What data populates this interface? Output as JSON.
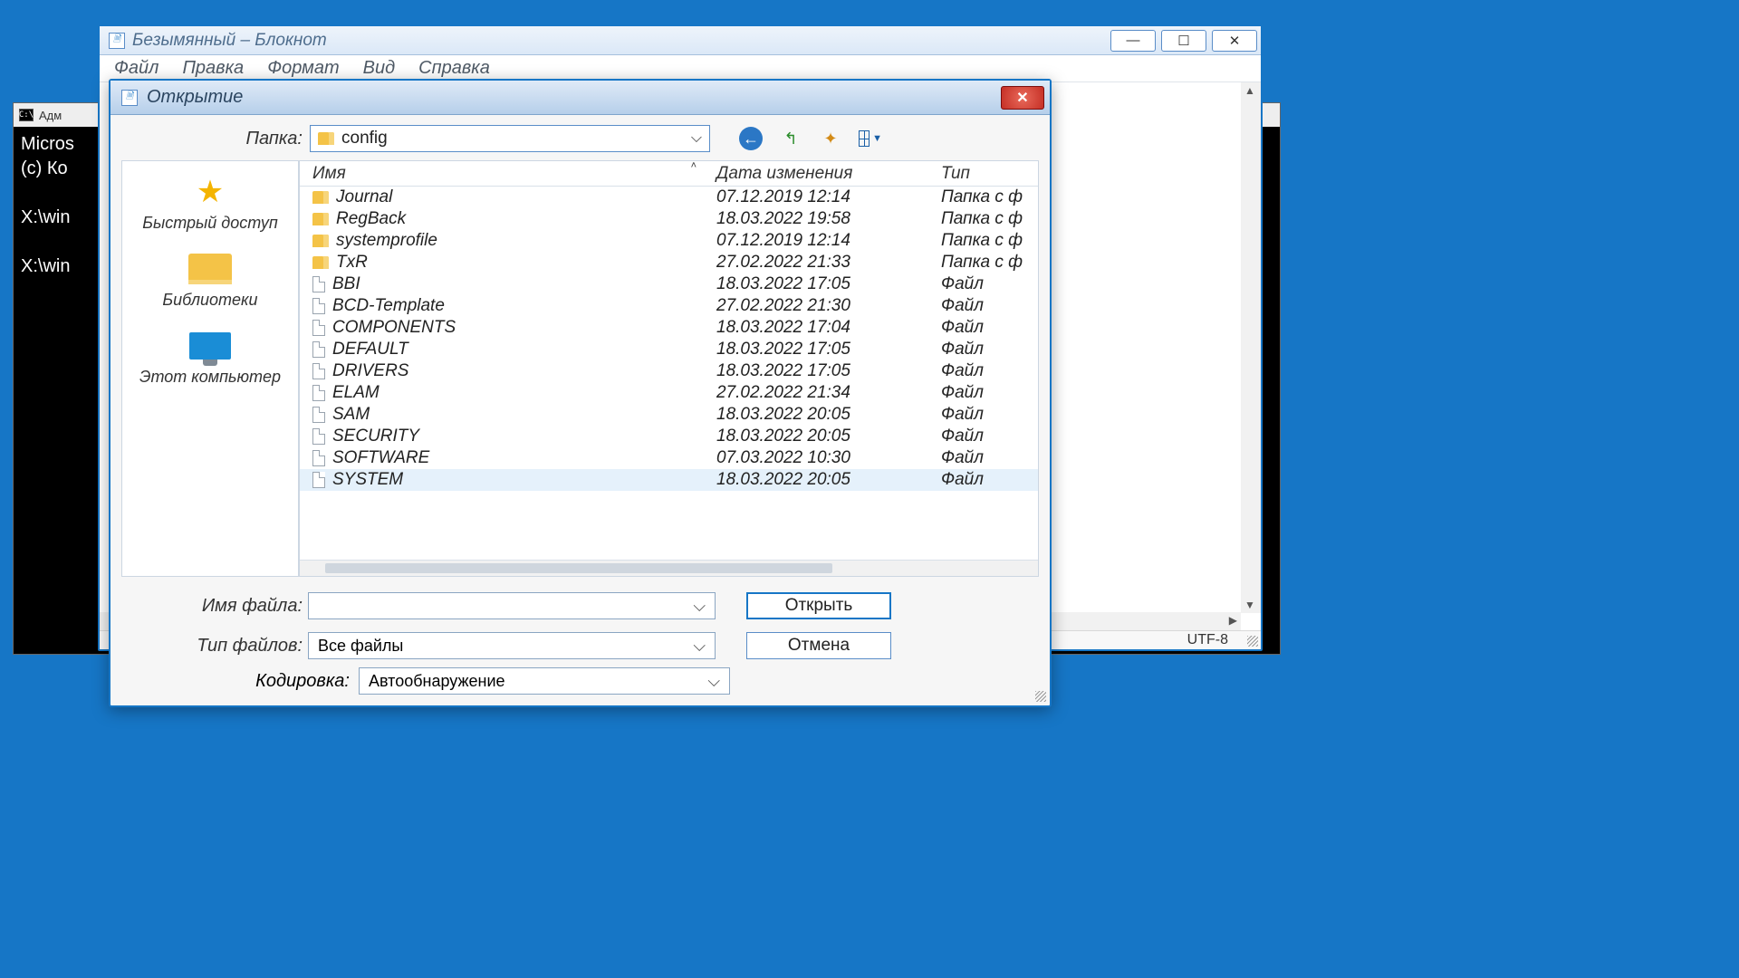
{
  "cmd": {
    "title": "Адм",
    "lines": [
      "Micros",
      "(c) Ко",
      "",
      "X:\\win",
      "",
      "X:\\win"
    ]
  },
  "notepad": {
    "title": "Безымянный – Блокнот",
    "menu": [
      "Файл",
      "Правка",
      "Формат",
      "Вид",
      "Справка"
    ],
    "status_encoding": "UTF-8"
  },
  "dialog": {
    "title": "Открытие",
    "folder_label": "Папка:",
    "folder_value": "config",
    "columns": {
      "name": "Имя",
      "date": "Дата изменения",
      "type": "Тип"
    },
    "places": {
      "quick": "Быстрый доступ",
      "libs": "Библиотеки",
      "pc": "Этот компьютер"
    },
    "rows": [
      {
        "icon": "folder",
        "name": "Journal",
        "date": "07.12.2019 12:14",
        "type": "Папка с ф"
      },
      {
        "icon": "folder",
        "name": "RegBack",
        "date": "18.03.2022 19:58",
        "type": "Папка с ф"
      },
      {
        "icon": "folder",
        "name": "systemprofile",
        "date": "07.12.2019 12:14",
        "type": "Папка с ф"
      },
      {
        "icon": "folder",
        "name": "TxR",
        "date": "27.02.2022 21:33",
        "type": "Папка с ф"
      },
      {
        "icon": "file",
        "name": "BBI",
        "date": "18.03.2022 17:05",
        "type": "Файл"
      },
      {
        "icon": "file",
        "name": "BCD-Template",
        "date": "27.02.2022 21:30",
        "type": "Файл"
      },
      {
        "icon": "file",
        "name": "COMPONENTS",
        "date": "18.03.2022 17:04",
        "type": "Файл"
      },
      {
        "icon": "file",
        "name": "DEFAULT",
        "date": "18.03.2022 17:05",
        "type": "Файл"
      },
      {
        "icon": "file",
        "name": "DRIVERS",
        "date": "18.03.2022 17:05",
        "type": "Файл"
      },
      {
        "icon": "file",
        "name": "ELAM",
        "date": "27.02.2022 21:34",
        "type": "Файл"
      },
      {
        "icon": "file",
        "name": "SAM",
        "date": "18.03.2022 20:05",
        "type": "Файл"
      },
      {
        "icon": "file",
        "name": "SECURITY",
        "date": "18.03.2022 20:05",
        "type": "Файл"
      },
      {
        "icon": "file",
        "name": "SOFTWARE",
        "date": "07.03.2022 10:30",
        "type": "Файл"
      },
      {
        "icon": "file",
        "name": "SYSTEM",
        "date": "18.03.2022 20:05",
        "type": "Файл",
        "hover": true
      }
    ],
    "filename_label": "Имя файла:",
    "filetype_label": "Тип файлов:",
    "filetype_value": "Все файлы",
    "encoding_label": "Кодировка:",
    "encoding_value": "Автообнаружение",
    "open_btn": "Открыть",
    "cancel_btn": "Отмена"
  }
}
